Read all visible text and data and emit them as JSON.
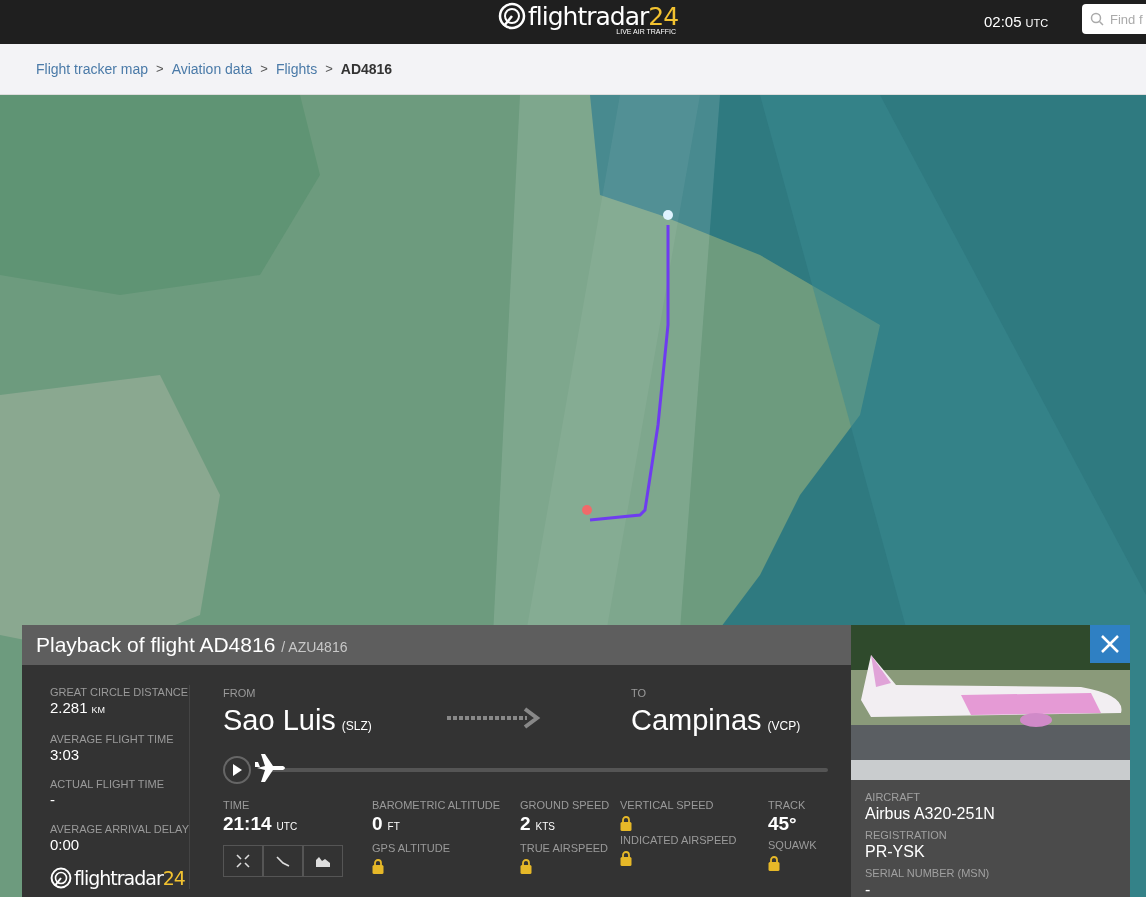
{
  "header": {
    "logo": {
      "name": "flightradar",
      "number": "24",
      "tagline": "LIVE AIR TRAFFIC"
    },
    "clock": {
      "time": "02:05",
      "zone": "UTC"
    },
    "search": {
      "placeholder": "Find f"
    }
  },
  "breadcrumb": [
    {
      "label": "Flight tracker map",
      "current": false
    },
    {
      "label": "Aviation data",
      "current": false
    },
    {
      "label": "Flights",
      "current": false
    },
    {
      "label": "AD4816",
      "current": true
    }
  ],
  "breadcrumb_separator": ">",
  "playback": {
    "title": "Playback of flight AD4816",
    "callsign": "/ AZU4816",
    "summary": [
      {
        "label": "GREAT CIRCLE DISTANCE",
        "value": "2.281",
        "unit": "KM"
      },
      {
        "label": "AVERAGE FLIGHT TIME",
        "value": "3:03"
      },
      {
        "label": "ACTUAL FLIGHT TIME",
        "value": "-"
      },
      {
        "label": "AVERAGE ARRIVAL DELAY",
        "value": "0:00"
      }
    ],
    "footer_logo": {
      "name": "flightradar",
      "number": "24"
    },
    "from": {
      "label": "FROM",
      "city": "Sao Luis",
      "code": "(SLZ)"
    },
    "to": {
      "label": "TO",
      "city": "Campinas",
      "code": "(VCP)"
    },
    "progress": {
      "level": 0.0,
      "playing": false
    },
    "time": {
      "label": "TIME",
      "value": "21:14",
      "unit": "UTC"
    },
    "stat_columns": [
      [
        {
          "label": "BAROMETRIC ALTITUDE",
          "value": "0",
          "unit": "FT",
          "locked": false
        },
        {
          "label": "GPS ALTITUDE",
          "locked": true
        }
      ],
      [
        {
          "label": "GROUND SPEED",
          "value": "2",
          "unit": "KTS",
          "locked": false
        },
        {
          "label": "TRUE AIRSPEED",
          "locked": true
        }
      ],
      [
        {
          "label": "VERTICAL SPEED",
          "locked": true
        },
        {
          "label": "INDICATED AIRSPEED",
          "locked": true
        }
      ],
      [
        {
          "label": "TRACK",
          "value": "45°",
          "locked": false
        },
        {
          "label": "SQUAWK",
          "locked": true
        }
      ]
    ],
    "aircraft": [
      {
        "label": "AIRCRAFT",
        "value": "Airbus A320-251N"
      },
      {
        "label": "REGISTRATION",
        "value": "PR-YSK"
      },
      {
        "label": "SERIAL NUMBER (MSN)",
        "value": "-"
      }
    ]
  }
}
